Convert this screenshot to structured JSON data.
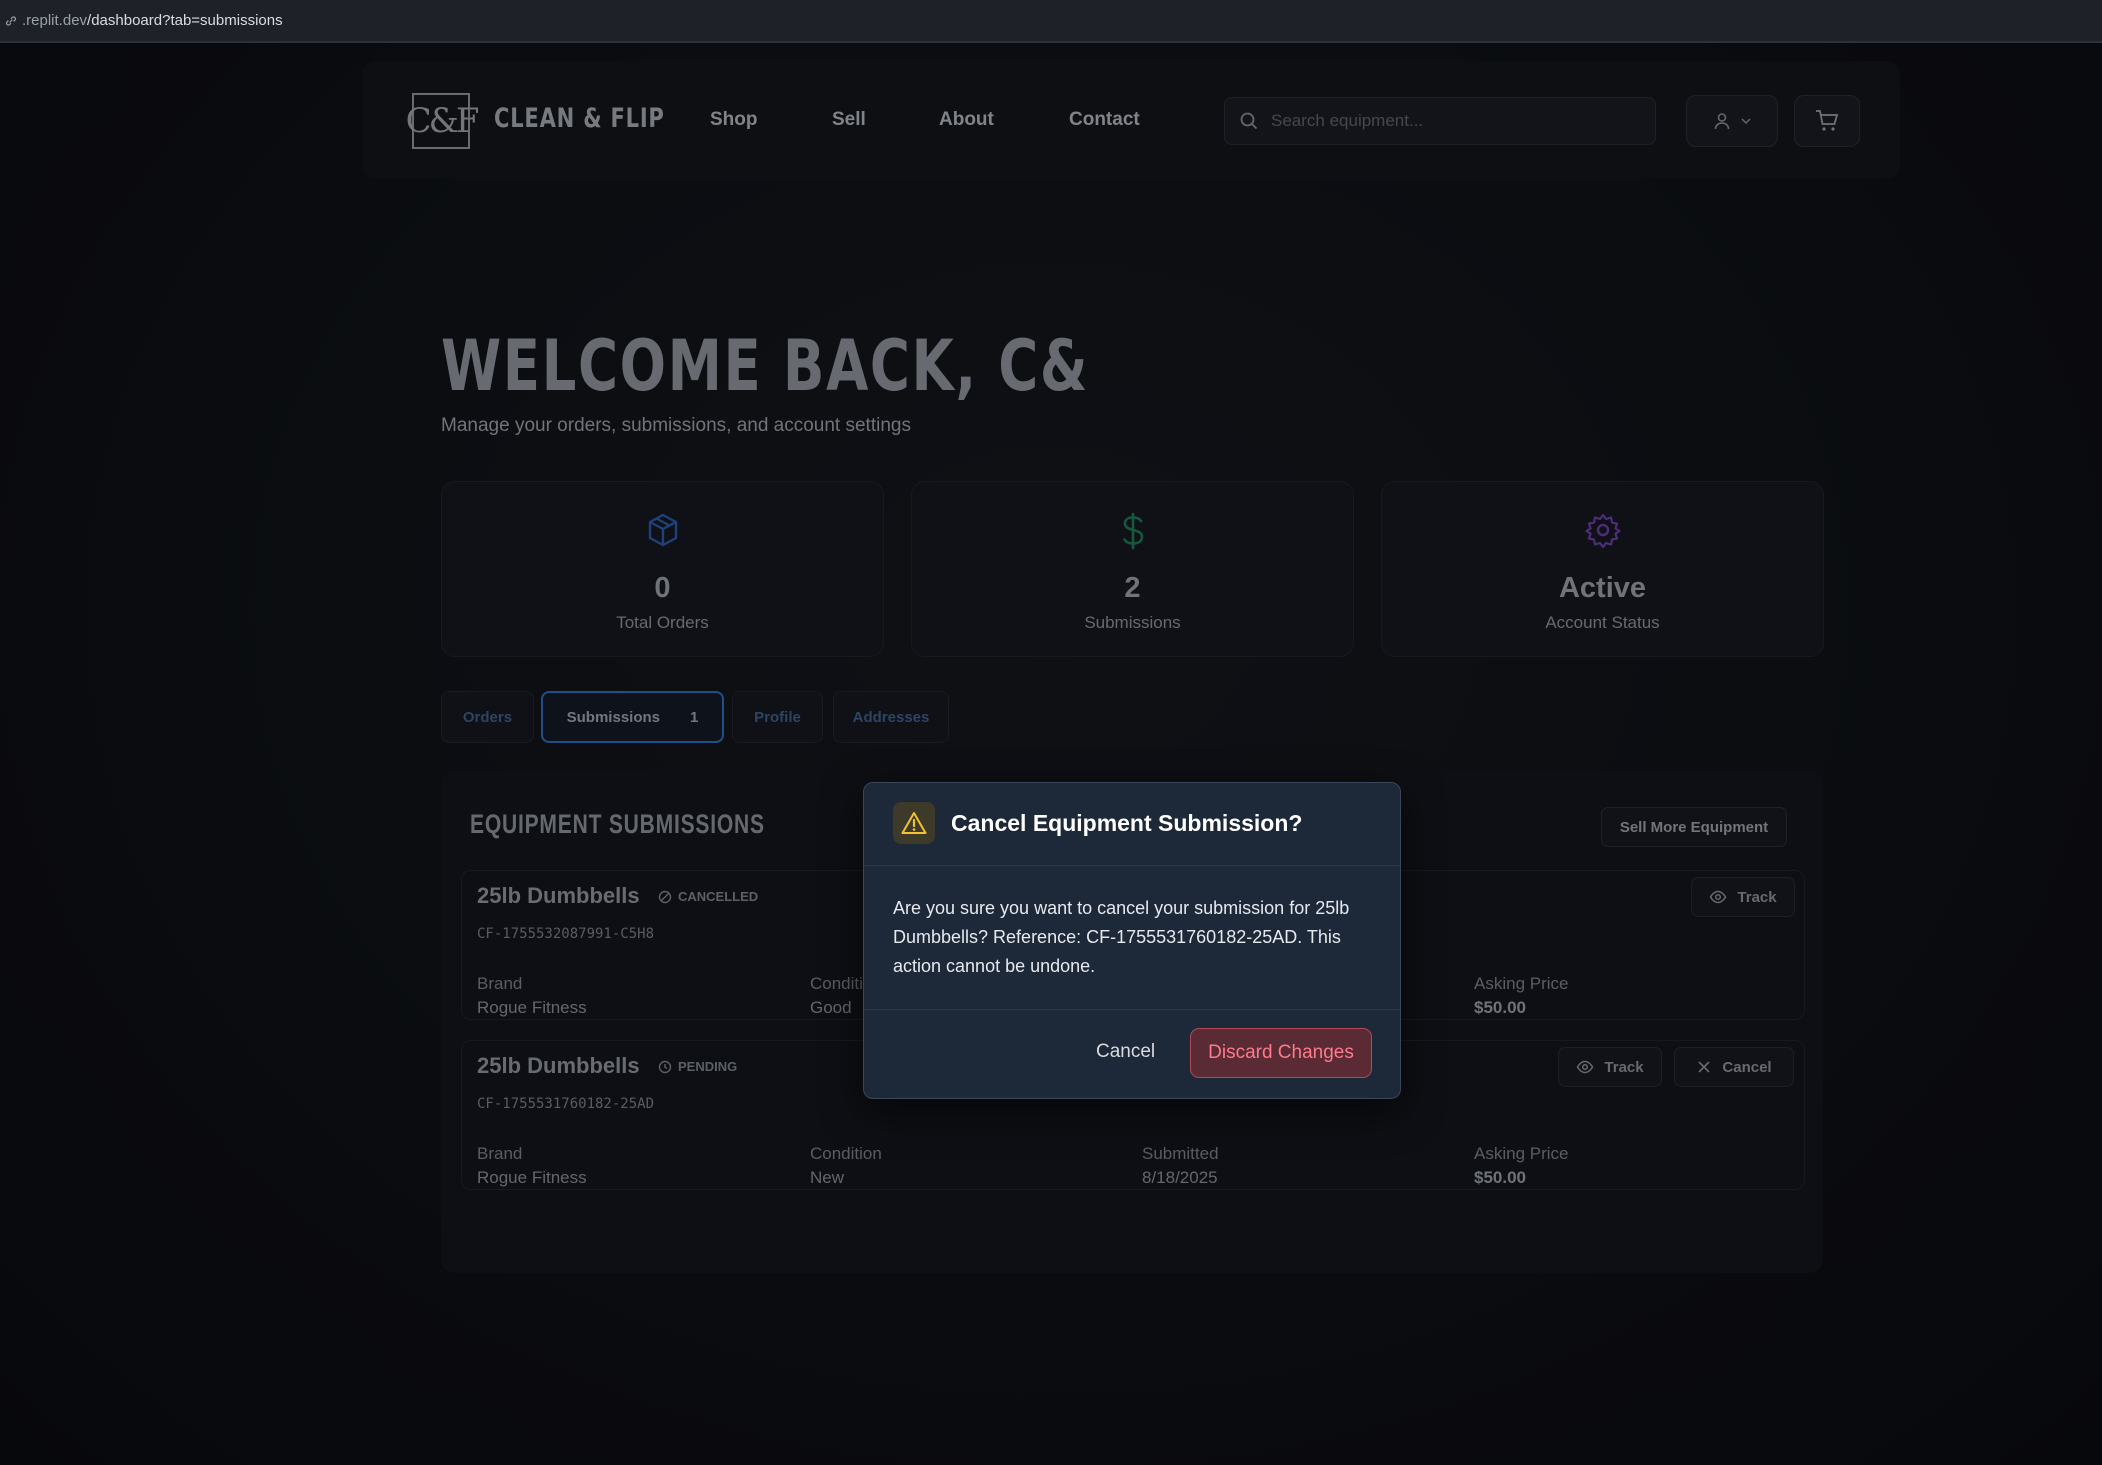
{
  "browser": {
    "url_dim": ".replit.dev",
    "url_path": "/dashboard?tab=submissions"
  },
  "nav": {
    "logo": "C&F",
    "brand": "CLEAN & FLIP",
    "links": [
      "Shop",
      "Sell",
      "About",
      "Contact"
    ],
    "search_placeholder": "Search equipment..."
  },
  "hero": {
    "title": "WELCOME BACK, C&",
    "subtitle": "Manage your orders, submissions, and account settings"
  },
  "stats": [
    {
      "value": "0",
      "label": "Total Orders",
      "icon": "package-icon",
      "color": "#2a5ba8"
    },
    {
      "value": "2",
      "label": "Submissions",
      "icon": "dollar-icon",
      "color": "#1f7a55"
    },
    {
      "value": "Active",
      "label": "Account Status",
      "icon": "gear-icon",
      "color": "#6a3fa8"
    }
  ],
  "tabs": [
    {
      "label": "Orders"
    },
    {
      "label": "Submissions",
      "count": "1",
      "active": true
    },
    {
      "label": "Profile"
    },
    {
      "label": "Addresses"
    }
  ],
  "panel": {
    "title": "EQUIPMENT SUBMISSIONS",
    "sell_button": "Sell More Equipment",
    "items": [
      {
        "name": "25lb Dumbbells",
        "status": "CANCELLED",
        "ref": "CF-1755532087991-C5H8",
        "brand_label": "Brand",
        "brand": "Rogue Fitness",
        "condition_label": "Conditi",
        "condition": "Good",
        "price_label": "Asking Price",
        "price": "$50.00",
        "track": "Track"
      },
      {
        "name": "25lb Dumbbells",
        "status": "PENDING",
        "ref": "CF-1755531760182-25AD",
        "brand_label": "Brand",
        "brand": "Rogue Fitness",
        "condition_label": "Condition",
        "condition": "New",
        "submitted_label": "Submitted",
        "submitted": "8/18/2025",
        "price_label": "Asking Price",
        "price": "$50.00",
        "track": "Track",
        "cancel": "Cancel"
      }
    ]
  },
  "modal": {
    "title": "Cancel Equipment Submission?",
    "body": "Are you sure you want to cancel your submission for 25lb Dumbbells? Reference: CF-1755531760182-25AD. This action cannot be undone.",
    "cancel": "Cancel",
    "confirm": "Discard Changes"
  }
}
